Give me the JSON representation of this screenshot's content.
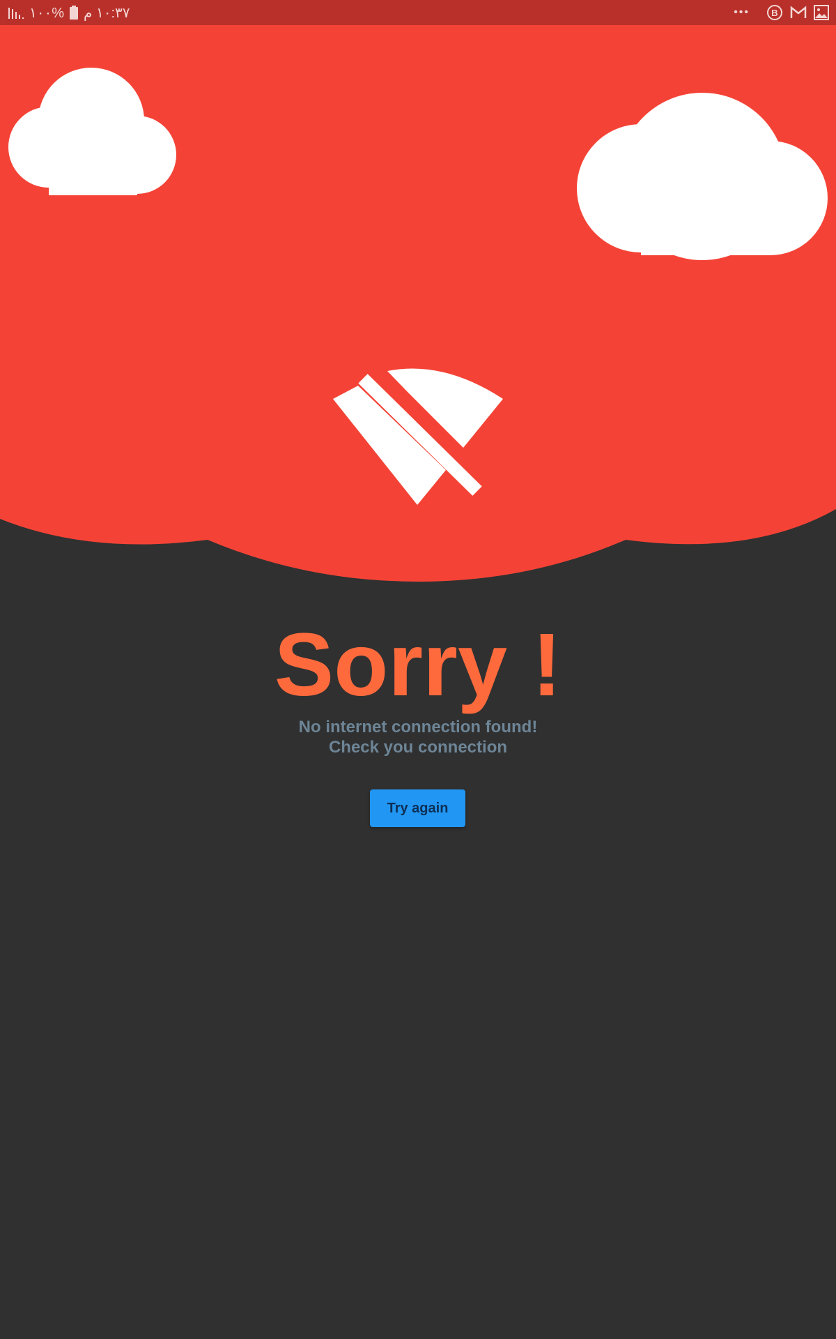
{
  "status_bar": {
    "time": "١٠:٣٧ م",
    "battery": "%١٠٠",
    "more": "•••",
    "background_color": "#b9302a",
    "icons": [
      "signal-icon",
      "battery-icon",
      "more-icon",
      "b-badge-icon",
      "gmail-icon",
      "gallery-icon"
    ]
  },
  "hero": {
    "background_color": "#f44336",
    "icons": [
      "cloud-icon",
      "cloud-icon",
      "wifi-off-icon"
    ]
  },
  "main": {
    "title": "Sorry !",
    "subtitle_line1": "No internet connection found!",
    "subtitle_line2": "Check you connection",
    "button_label": "Try again"
  },
  "colors": {
    "background": "#303030",
    "title": "#ff6a3d",
    "subtitle": "#6d8596",
    "button": "#2196f3",
    "button_text": "#0d2f55"
  }
}
